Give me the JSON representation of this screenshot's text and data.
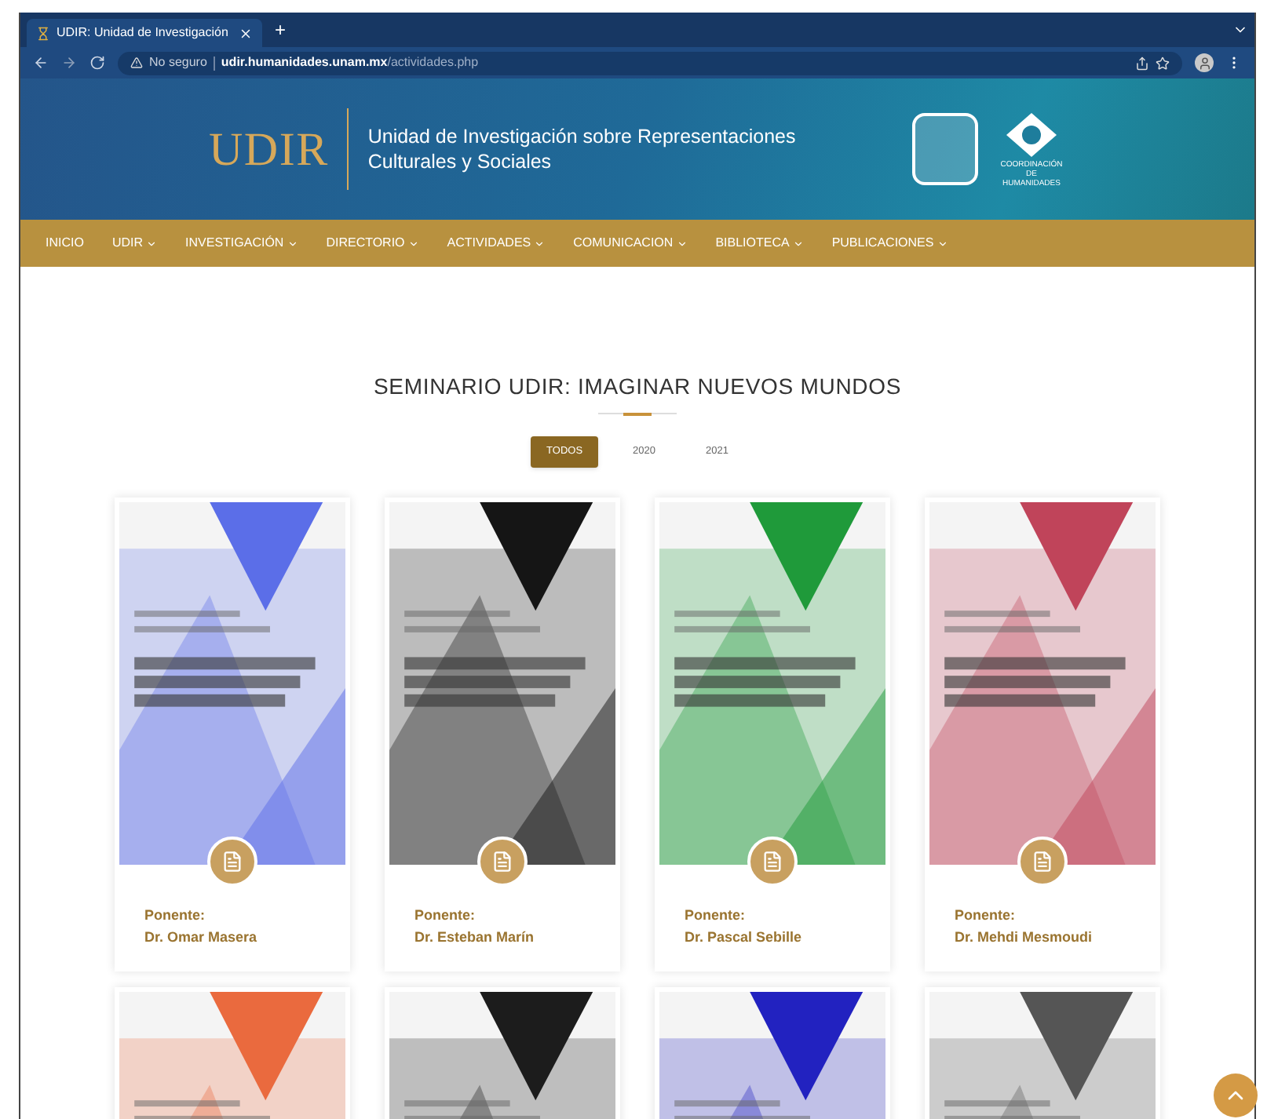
{
  "browser": {
    "tab_title": "UDIR: Unidad de Investigación",
    "new_tab": "+",
    "security": "No seguro",
    "url_host": "udir.humanidades.unam.mx",
    "url_path": "/actividades.php"
  },
  "header": {
    "logo": "UDIR",
    "title": "Unidad de Investigación sobre Representaciones Culturales y Sociales",
    "partner": "COORDINACIÓN DE HUMANIDADES"
  },
  "nav": [
    {
      "label": "INICIO",
      "dropdown": false
    },
    {
      "label": "UDIR",
      "dropdown": true
    },
    {
      "label": "INVESTIGACIÓN",
      "dropdown": true
    },
    {
      "label": "DIRECTORIO",
      "dropdown": true
    },
    {
      "label": "ACTIVIDADES",
      "dropdown": true
    },
    {
      "label": "COMUNICACION",
      "dropdown": true
    },
    {
      "label": "BIBLIOTECA",
      "dropdown": true
    },
    {
      "label": "PUBLICACIONES",
      "dropdown": true
    }
  ],
  "section_title": "SEMINARIO UDIR: IMAGINAR NUEVOS MUNDOS",
  "filters": [
    {
      "label": "TODOS",
      "selected": true
    },
    {
      "label": "2020",
      "selected": false
    },
    {
      "label": "2021",
      "selected": false
    }
  ],
  "cards": [
    {
      "color": "#5b6ee8",
      "label": "Ponente:",
      "speaker": "Dr. Omar Masera"
    },
    {
      "color": "#151515",
      "label": "Ponente:",
      "speaker": "Dr. Esteban Marín"
    },
    {
      "color": "#1f9a3a",
      "label": "Ponente:",
      "speaker": "Dr. Pascal Sebille"
    },
    {
      "color": "#c0445a",
      "label": "Ponente:",
      "speaker": "Dr. Mehdi Mesmoudi"
    },
    {
      "color": "#ea6a3e"
    },
    {
      "color": "#1c1c1c"
    },
    {
      "color": "#2222c0"
    },
    {
      "color": "#555555"
    }
  ]
}
